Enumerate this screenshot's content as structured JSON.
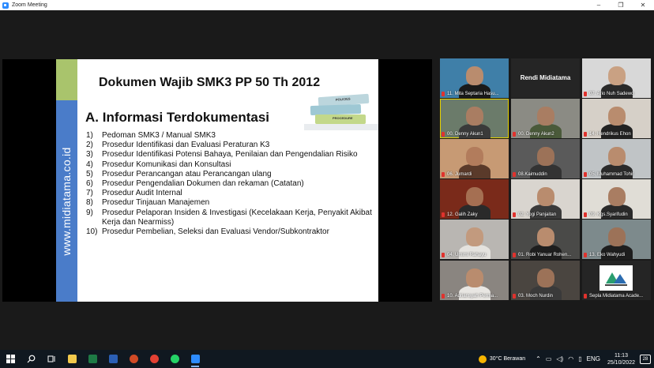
{
  "window": {
    "title": "Zoom Meeting",
    "controls": {
      "minimize": "–",
      "maximize": "❐",
      "close": "✕"
    }
  },
  "slide": {
    "side_text": "www.midiatama.co.id",
    "heading": "Dokumen Wajib SMK3 PP 50 Th 2012",
    "section": "A. Informasi Terdokumentasi",
    "folder_labels": [
      "POLICIES",
      "PROCEDURE"
    ],
    "items": [
      {
        "num": "1)",
        "text": "Pedoman SMK3 / Manual SMK3"
      },
      {
        "num": "2)",
        "text": "Prosedur Identifikasi dan Evaluasi Peraturan K3"
      },
      {
        "num": "3)",
        "text": "Prosedur Identifikasi Potensi Bahaya, Penilaian dan Pengendalian Risiko"
      },
      {
        "num": "4)",
        "text": "Prosedur Komunikasi dan Konsultasi"
      },
      {
        "num": "5)",
        "text": "Prosedur Perancangan atau Perancangan ulang"
      },
      {
        "num": "6)",
        "text": "Prosedur Pengendalian Dokumen dan rekaman (Catatan)"
      },
      {
        "num": "7)",
        "text": "Prosedur Audit Internal"
      },
      {
        "num": "8)",
        "text": "Prosedur Tinjauan Manajemen"
      },
      {
        "num": "9)",
        "text": "Prosedur Pelaporan Insiden & Investigasi (Kecelakaan Kerja, Penyakit Akibat Kerja dan Nearmiss)"
      },
      {
        "num": "10)",
        "text": "Prosedur Pembelian, Seleksi dan Evaluasi Vendor/Subkontraktor"
      }
    ]
  },
  "participants": [
    {
      "name": "11. Mita Septaria Hasu...",
      "bg": "#3f7fa8",
      "skin": "#b98c6e",
      "shirt": "#1a1a1a",
      "muted": true
    },
    {
      "name": "Rendi Midiatama",
      "bg": "#252525",
      "center": true,
      "muted": false
    },
    {
      "name": "07. Ario Nuh Sadewo",
      "bg": "#d8d8d8",
      "skin": "#c9a183",
      "shirt": "#2a2a2a",
      "muted": true
    },
    {
      "name": "00. Denny Akun1",
      "bg": "#6b7b6a",
      "skin": "#a97d62",
      "shirt": "#3a3a3a",
      "muted": true,
      "active": true
    },
    {
      "name": "00. Denny Akun2",
      "bg": "#8b8b84",
      "skin": "#a97d62",
      "shirt": "#4a5a3a",
      "muted": true
    },
    {
      "name": "14. Hendrikus Ehon",
      "bg": "#d6d0c8",
      "skin": "#b98c6e",
      "shirt": "#222",
      "muted": true
    },
    {
      "name": "06. Jumardi",
      "bg": "#c79a74",
      "skin": "#b27c5c",
      "shirt": "#5a3a2a",
      "muted": true
    },
    {
      "name": "08.Kaimuddin",
      "bg": "#5a5a5a",
      "skin": "#9c7258",
      "shirt": "#333",
      "muted": true
    },
    {
      "name": "05. Muhammad Tohir",
      "bg": "#c0c4c6",
      "skin": "#b98c6e",
      "shirt": "#2b2b2b",
      "muted": true
    },
    {
      "name": "12. Galih Zaky",
      "bg": "#7a2a1a",
      "skin": "#a56f52",
      "shirt": "#2a2a2a",
      "muted": true
    },
    {
      "name": "02. Yogi Panjaitan",
      "bg": "#d9d5cf",
      "skin": "#b98c6e",
      "shirt": "#3a3a3a",
      "muted": true
    },
    {
      "name": "09. Kgs.Syarifudin",
      "bg": "#e0ddd6",
      "skin": "#a97d62",
      "shirt": "#2a2a2a",
      "muted": true
    },
    {
      "name": "04. Umimi Rahayu",
      "bg": "#b9b6b2",
      "skin": "#c29a7e",
      "shirt": "#e4e2de",
      "muted": true
    },
    {
      "name": "01. Robi Yanuar Rohen...",
      "bg": "#4a4a48",
      "skin": "#b98c6e",
      "shirt": "#1e1e1e",
      "muted": true
    },
    {
      "name": "13. Eko Wahyudi",
      "bg": "#7d8a8c",
      "skin": "#9c7258",
      "shirt": "#1e1e1e",
      "muted": true
    },
    {
      "name": "10. Adriansyah Perma...",
      "bg": "#8a8580",
      "skin": "#b98c6e",
      "shirt": "#e8e6e2",
      "muted": true
    },
    {
      "name": "03. Moch Nurdin",
      "bg": "#4a4540",
      "skin": "#9c7258",
      "shirt": "#3a3a3a",
      "muted": true
    },
    {
      "name": "Sepla Midiatama Acade...",
      "bg": "#252525",
      "logo": true,
      "muted": true
    }
  ],
  "logo": {
    "brand": "Midiatama Academy"
  },
  "taskbar": {
    "weather": "30°C  Berawan",
    "lang": "ENG",
    "time": "11:13",
    "date": "25/10/2022",
    "notifications": "28",
    "apps": [
      {
        "name": "file-explorer-icon",
        "color": "#f2c94c"
      },
      {
        "name": "excel-icon",
        "color": "#1e7a45"
      },
      {
        "name": "word-icon",
        "color": "#2b5fb4"
      },
      {
        "name": "powerpoint-icon",
        "color": "#d04a25"
      },
      {
        "name": "chrome-icon",
        "color": "#e34133"
      },
      {
        "name": "whatsapp-icon",
        "color": "#25d366"
      },
      {
        "name": "zoom-icon",
        "color": "#2d8cff"
      }
    ]
  }
}
